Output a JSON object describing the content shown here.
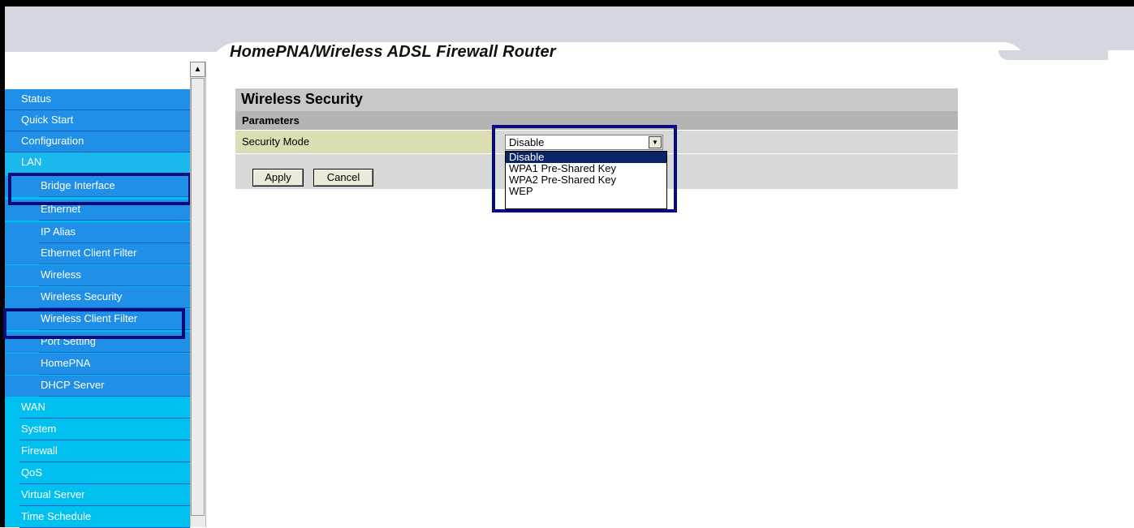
{
  "app": {
    "title": "HomePNA/Wireless ADSL Firewall Router"
  },
  "nav": {
    "items": [
      {
        "label": "Status"
      },
      {
        "label": "Quick Start"
      },
      {
        "label": "Configuration"
      },
      {
        "label": "LAN"
      },
      {
        "label": "Bridge Interface"
      },
      {
        "label": "Ethernet"
      },
      {
        "label": "IP Alias"
      },
      {
        "label": "Ethernet Client Filter"
      },
      {
        "label": "Wireless"
      },
      {
        "label": "Wireless Security"
      },
      {
        "label": "Wireless Client Filter"
      },
      {
        "label": "Port Setting"
      },
      {
        "label": "HomePNA"
      },
      {
        "label": "DHCP Server"
      },
      {
        "label": "WAN"
      },
      {
        "label": "System"
      },
      {
        "label": "Firewall"
      },
      {
        "label": "QoS"
      },
      {
        "label": "Virtual Server"
      },
      {
        "label": "Time Schedule"
      }
    ]
  },
  "page": {
    "heading": "Wireless Security",
    "section": "Parameters",
    "security_mode_label": "Security Mode",
    "security_mode_value": "Disable",
    "options": [
      "Disable",
      "WPA1 Pre-Shared Key",
      "WPA2 Pre-Shared Key",
      "WEP"
    ],
    "apply_label": "Apply",
    "cancel_label": "Cancel"
  },
  "colors": {
    "nav": "#00c0f0",
    "highlight_box": "#0a0a78",
    "selected_option": "#0a246a"
  }
}
